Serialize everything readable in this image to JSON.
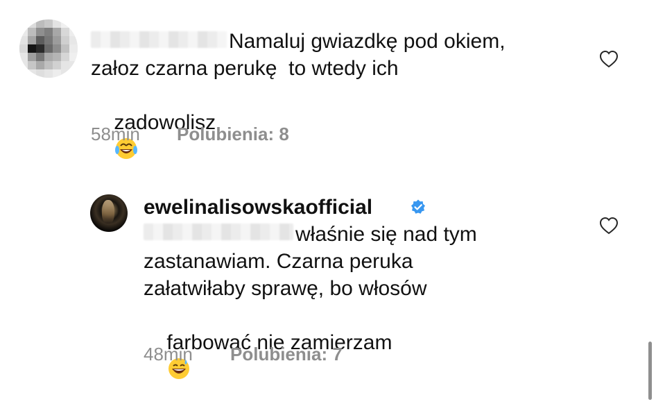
{
  "comments": [
    {
      "author_hidden": true,
      "text_line1": "Namaluj gwiazdkę pod okiem,",
      "text_line2": "załoz czarna perukę  to wtedy ich",
      "text_line3": "zadowolisz",
      "emoji": "tears-of-joy-emoji",
      "time": "58min",
      "likes_label": "Polubienia: 8"
    },
    {
      "author": "ewelinalisowskaofficial",
      "verified": true,
      "mention_hidden": true,
      "text_line1": "właśnie się nad tym",
      "text_line2": "zastanawiam. Czarna peruka",
      "text_line3": "załatwiłaby sprawę, bo włosów",
      "text_line4": "farbować nie zamierzam",
      "emoji": "grinning-sweat-emoji",
      "time": "48min",
      "likes_label": "Polubienia: 7"
    }
  ],
  "icons": {
    "like": "heart-outline-icon",
    "verified": "verified-badge-icon"
  },
  "colors": {
    "text": "#111111",
    "meta": "#8e8e8e",
    "verified": "#3897f0"
  }
}
